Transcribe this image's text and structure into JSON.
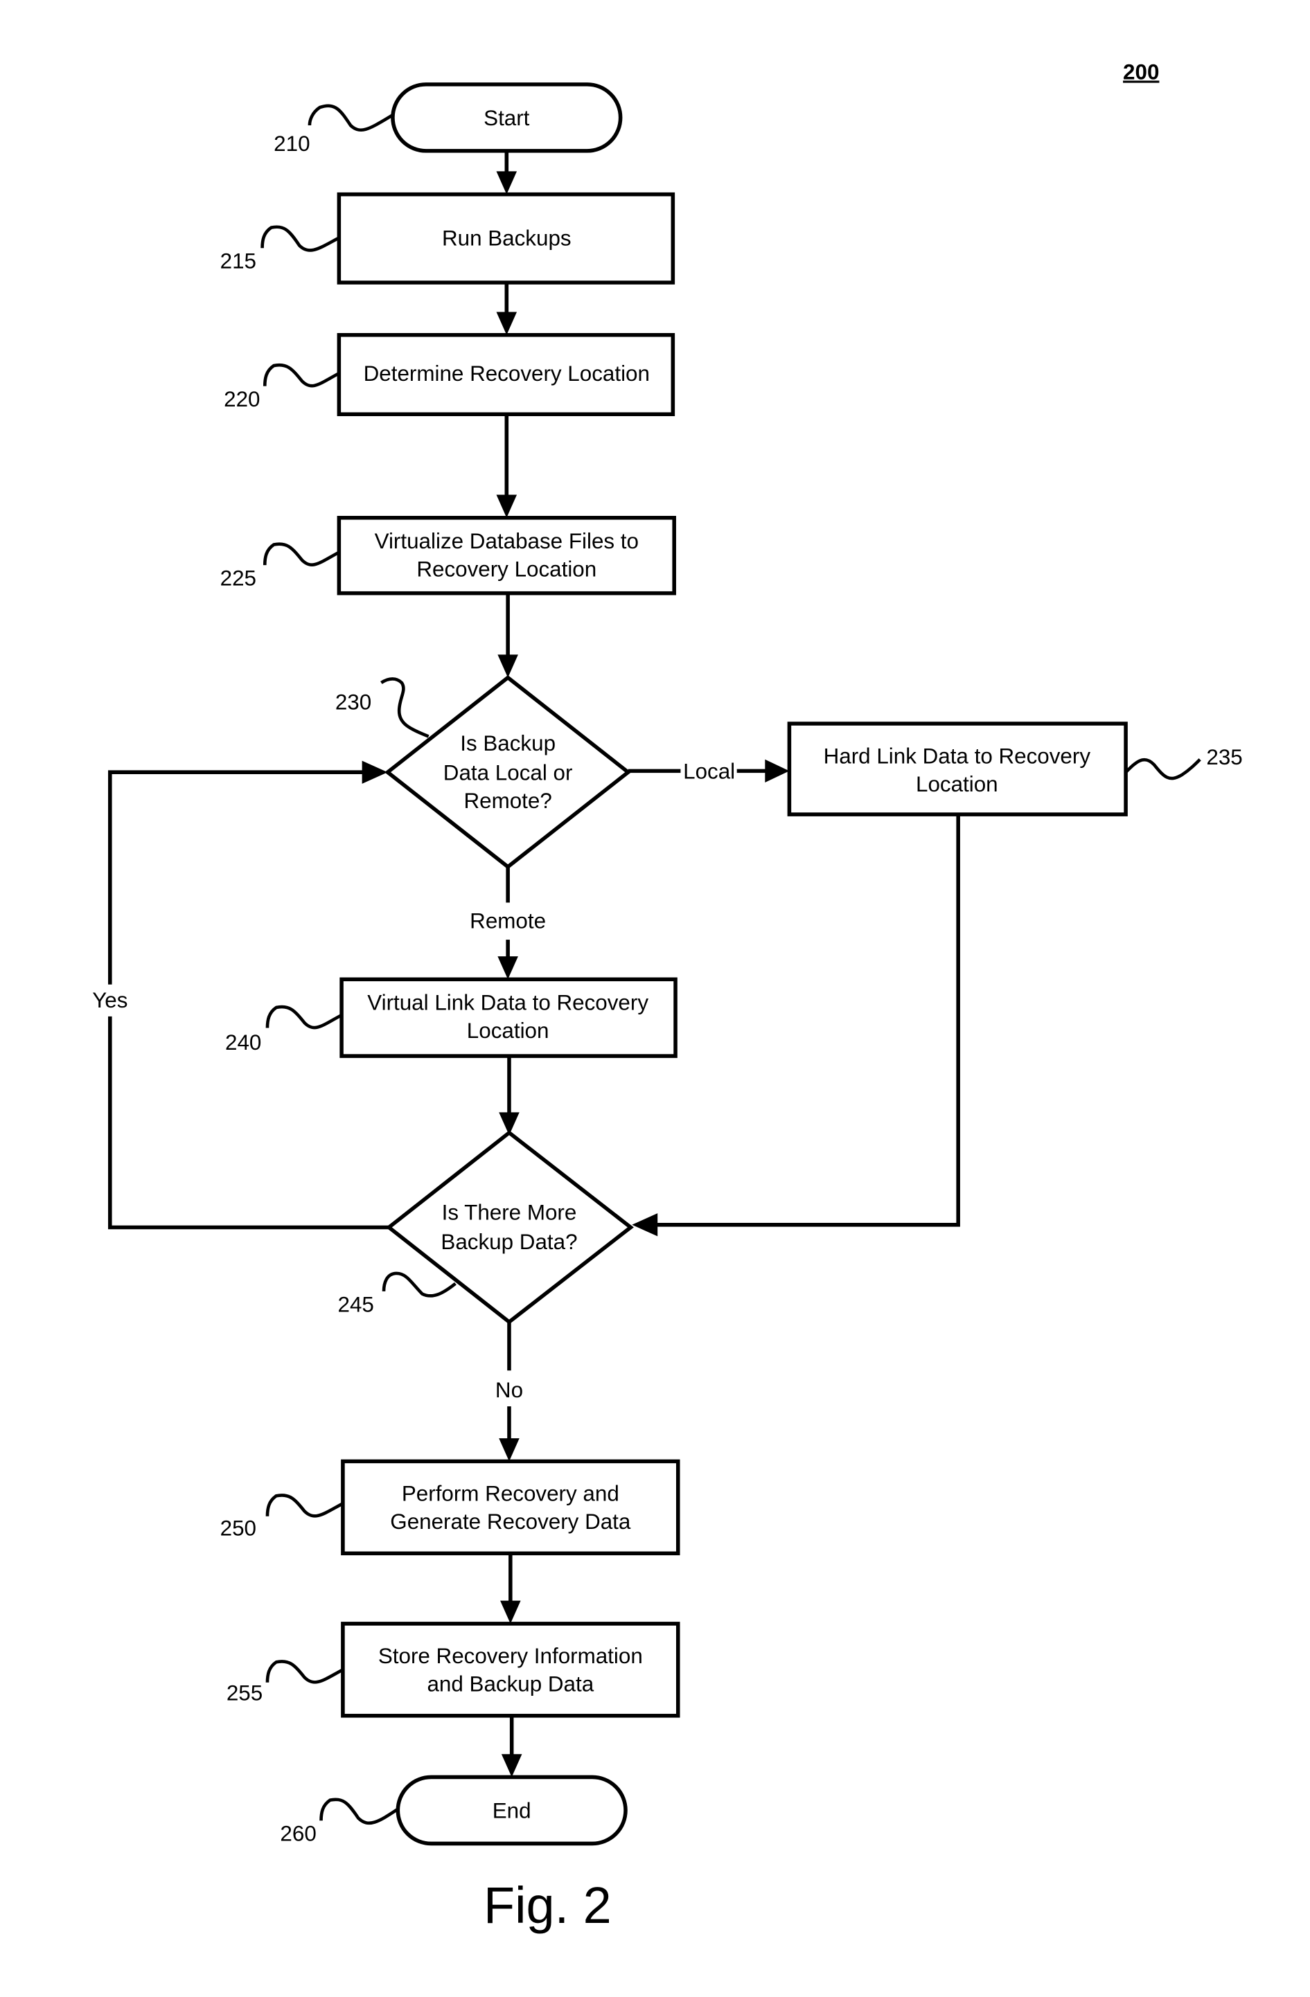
{
  "figure": {
    "number": "200",
    "caption": "Fig. 2"
  },
  "nodes": {
    "start": {
      "ref": "210",
      "label": [
        "Start"
      ]
    },
    "run_backups": {
      "ref": "215",
      "label": [
        "Run Backups"
      ]
    },
    "determine_location": {
      "ref": "220",
      "label": [
        "Determine Recovery Location"
      ]
    },
    "virtualize_db": {
      "ref": "225",
      "label": [
        "Virtualize Database Files to",
        "Recovery Location"
      ]
    },
    "local_or_remote": {
      "ref": "230",
      "label": [
        "Is Backup",
        "Data Local or",
        "Remote?"
      ]
    },
    "hard_link": {
      "ref": "235",
      "label": [
        "Hard Link Data to Recovery",
        "Location"
      ]
    },
    "virtual_link": {
      "ref": "240",
      "label": [
        "Virtual Link Data to Recovery",
        "Location"
      ]
    },
    "more_data": {
      "ref": "245",
      "label": [
        "Is There More",
        "Backup Data?"
      ]
    },
    "perform_recovery": {
      "ref": "250",
      "label": [
        "Perform Recovery and",
        "Generate Recovery Data"
      ]
    },
    "store_info": {
      "ref": "255",
      "label": [
        "Store Recovery Information",
        "and Backup Data"
      ]
    },
    "end": {
      "ref": "260",
      "label": [
        "End"
      ]
    }
  },
  "edges": {
    "local": "Local",
    "remote": "Remote",
    "yes": "Yes",
    "no": "No"
  }
}
